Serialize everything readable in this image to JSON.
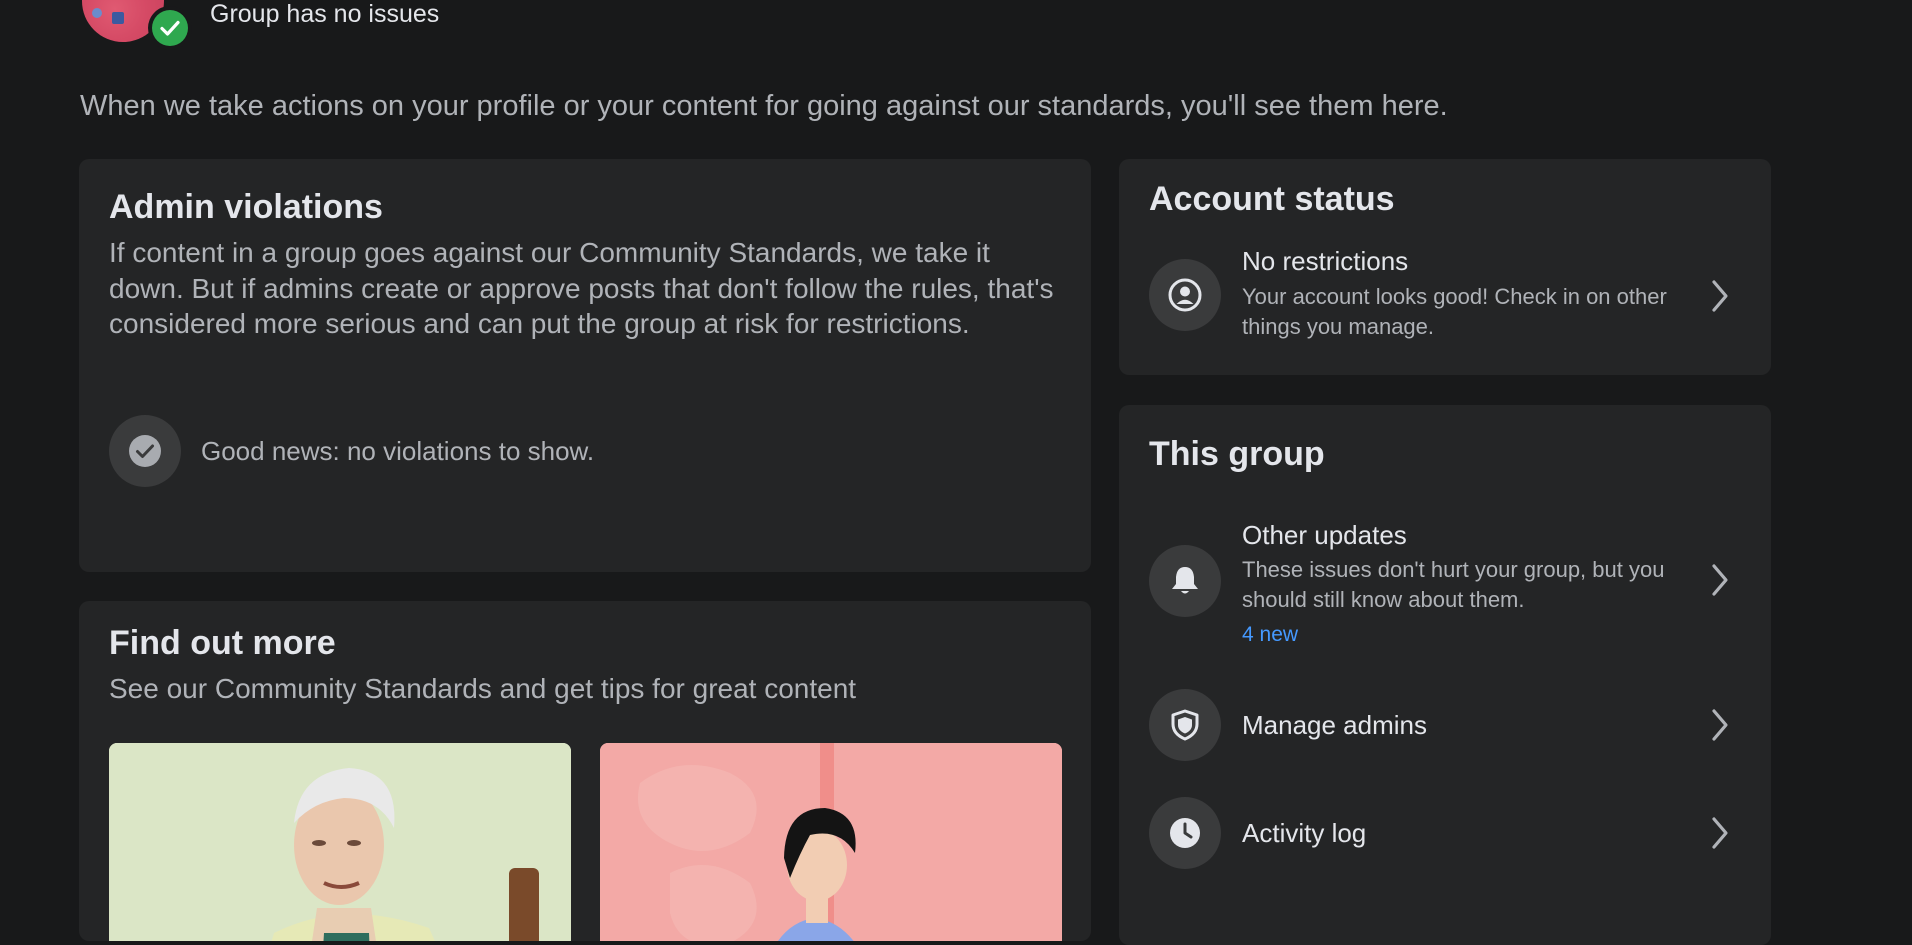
{
  "header": {
    "group_status": "Group has no issues",
    "intro": "When we take actions on your profile or your content for going against our standards, you'll see them here."
  },
  "admin_violations": {
    "title": "Admin violations",
    "description": "If content in a group goes against our Community Standards, we take it down. But if admins create or approve posts that don't follow the rules, that's considered more serious and can put the group at risk for restrictions.",
    "empty_state": "Good news: no violations to show."
  },
  "find_out_more": {
    "title": "Find out more",
    "subtitle": "See our Community Standards and get tips for great content"
  },
  "account_status": {
    "title": "Account status",
    "item": {
      "title": "No restrictions",
      "subtitle": "Your account looks good! Check in on other things you manage."
    }
  },
  "this_group": {
    "title": "This group",
    "items": [
      {
        "title": "Other updates",
        "subtitle": "These issues don't hurt your group, but you should still know about them.",
        "badge": "4 new",
        "icon": "bell-icon"
      },
      {
        "title": "Manage admins",
        "icon": "shield-icon"
      },
      {
        "title": "Activity log",
        "icon": "clock-icon"
      }
    ]
  },
  "colors": {
    "background": "#18191a",
    "card": "#242526",
    "icon_circle": "#3a3b3c",
    "accent_link": "#4599ff",
    "success_green": "#2fa84f"
  }
}
